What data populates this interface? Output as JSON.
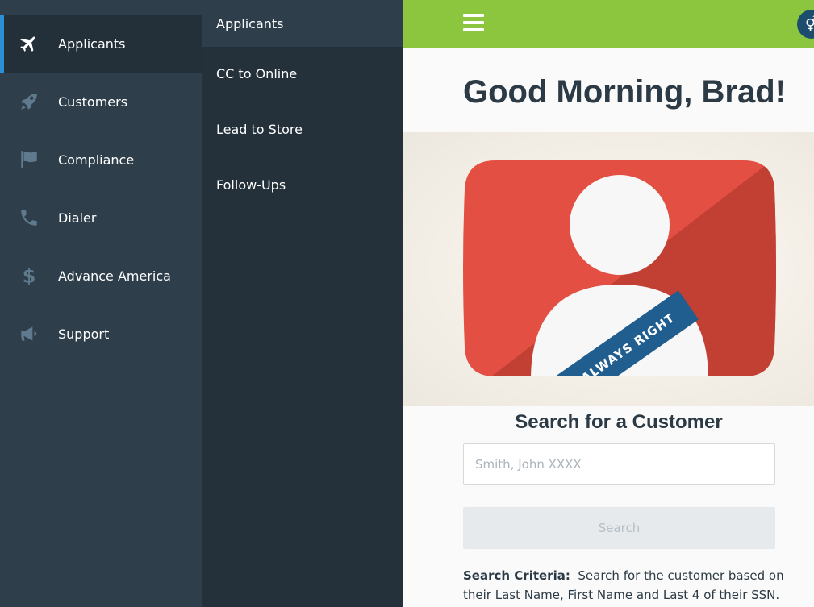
{
  "sidebar": {
    "items": [
      {
        "label": "Applicants",
        "icon": "airplane-icon",
        "active": true
      },
      {
        "label": "Customers",
        "icon": "rocket-icon"
      },
      {
        "label": "Compliance",
        "icon": "flag-icon"
      },
      {
        "label": "Dialer",
        "icon": "phone-icon"
      },
      {
        "label": "Advance America",
        "icon": "dollar-icon"
      },
      {
        "label": "Support",
        "icon": "megaphone-icon"
      }
    ]
  },
  "subnav": {
    "title": "Applicants",
    "items": [
      "CC to Online",
      "Lead to Store",
      "Follow-Ups"
    ]
  },
  "topbar": {
    "menu_icon": "hamburger-icon",
    "badge_icon": "gender-icon"
  },
  "main": {
    "greeting": "Good Morning, Brad!",
    "hero": {
      "sash_text": "ALWAYS RIGHT"
    },
    "search": {
      "title": "Search for a Customer",
      "placeholder": "Smith, John XXXX",
      "button_label": "Search",
      "criteria_label": "Search Criteria:",
      "criteria_text": "Search for the customer based on their Last Name, First Name and Last 4 of their SSN."
    }
  },
  "colors": {
    "sidebar": "#2e3e4a",
    "subpanel": "#24313b",
    "accent_green": "#8cc63f",
    "active_bar": "#2b8fd6",
    "hero_red": "#e34f42",
    "sash_blue": "#1f5e8f"
  }
}
